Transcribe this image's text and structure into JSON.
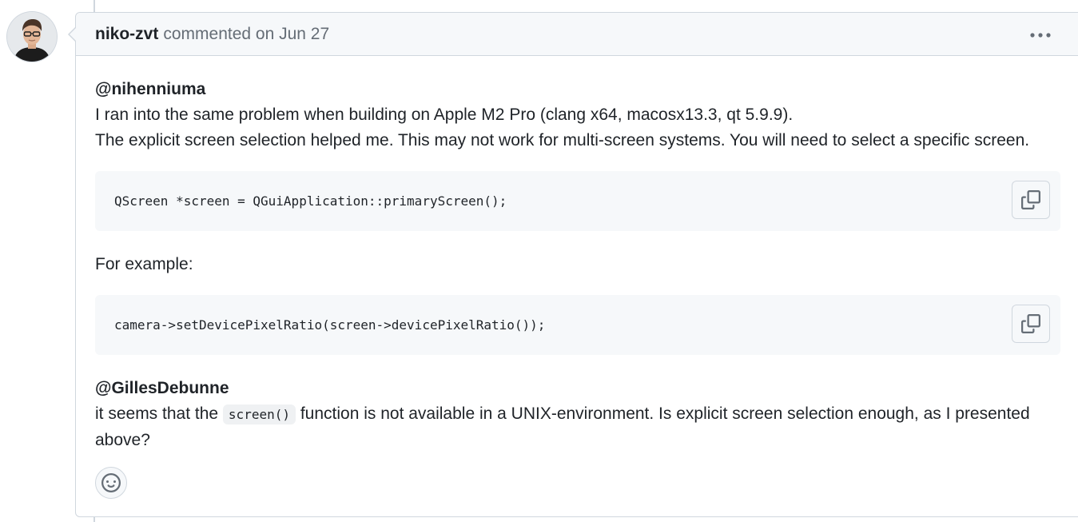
{
  "comment": {
    "author": "niko-zvt",
    "action": "commented on",
    "date": "Jun 27",
    "body": {
      "mention1": "@nihenniuma",
      "line1": "I ran into the same problem when building on Apple M2 Pro (clang x64, macosx13.3, qt 5.9.9).",
      "line2": "The explicit screen selection helped me. This may not work for multi-screen systems. You will need to select a specific screen.",
      "code1": "QScreen *screen = QGuiApplication::primaryScreen();",
      "example_label": "For example:",
      "code2": "camera->setDevicePixelRatio(screen->devicePixelRatio());",
      "mention2": "@GillesDebunne",
      "line3_before": "it seems that the",
      "inline_code": "screen()",
      "line3_after": "function is not available in a UNIX-environment. Is explicit screen selection enough, as I presented above?"
    }
  },
  "icons": {
    "more": "kebab-horizontal-icon",
    "copy": "copy-icon",
    "reaction": "smiley-icon"
  },
  "colors": {
    "border": "#d0d7de",
    "header_bg": "#f6f8fa",
    "muted_text": "#656d76",
    "text": "#1f2328"
  }
}
